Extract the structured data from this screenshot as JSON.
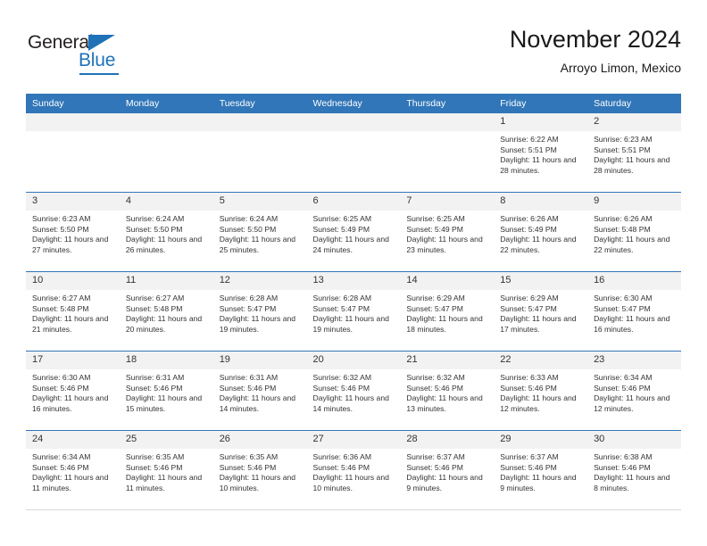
{
  "brand": {
    "name_part1": "General",
    "name_part2": "Blue",
    "triangle_icon": "blue-triangle-logo-mark",
    "accent_color": "#1f72b8"
  },
  "header": {
    "title": "November 2024",
    "subtitle": "Arroyo Limon, Mexico"
  },
  "theme": {
    "header_blue": "#3176b8",
    "daynum_band": "#f2f2f2",
    "text": "#333333"
  },
  "calendar": {
    "weekday_headers": [
      "Sunday",
      "Monday",
      "Tuesday",
      "Wednesday",
      "Thursday",
      "Friday",
      "Saturday"
    ],
    "weeks": [
      [
        {
          "day": "",
          "lines": []
        },
        {
          "day": "",
          "lines": []
        },
        {
          "day": "",
          "lines": []
        },
        {
          "day": "",
          "lines": []
        },
        {
          "day": "",
          "lines": []
        },
        {
          "day": "1",
          "lines": [
            "Sunrise: 6:22 AM",
            "Sunset: 5:51 PM",
            "Daylight: 11 hours and 28 minutes."
          ]
        },
        {
          "day": "2",
          "lines": [
            "Sunrise: 6:23 AM",
            "Sunset: 5:51 PM",
            "Daylight: 11 hours and 28 minutes."
          ]
        }
      ],
      [
        {
          "day": "3",
          "lines": [
            "Sunrise: 6:23 AM",
            "Sunset: 5:50 PM",
            "Daylight: 11 hours and 27 minutes."
          ]
        },
        {
          "day": "4",
          "lines": [
            "Sunrise: 6:24 AM",
            "Sunset: 5:50 PM",
            "Daylight: 11 hours and 26 minutes."
          ]
        },
        {
          "day": "5",
          "lines": [
            "Sunrise: 6:24 AM",
            "Sunset: 5:50 PM",
            "Daylight: 11 hours and 25 minutes."
          ]
        },
        {
          "day": "6",
          "lines": [
            "Sunrise: 6:25 AM",
            "Sunset: 5:49 PM",
            "Daylight: 11 hours and 24 minutes."
          ]
        },
        {
          "day": "7",
          "lines": [
            "Sunrise: 6:25 AM",
            "Sunset: 5:49 PM",
            "Daylight: 11 hours and 23 minutes."
          ]
        },
        {
          "day": "8",
          "lines": [
            "Sunrise: 6:26 AM",
            "Sunset: 5:49 PM",
            "Daylight: 11 hours and 22 minutes."
          ]
        },
        {
          "day": "9",
          "lines": [
            "Sunrise: 6:26 AM",
            "Sunset: 5:48 PM",
            "Daylight: 11 hours and 22 minutes."
          ]
        }
      ],
      [
        {
          "day": "10",
          "lines": [
            "Sunrise: 6:27 AM",
            "Sunset: 5:48 PM",
            "Daylight: 11 hours and 21 minutes."
          ]
        },
        {
          "day": "11",
          "lines": [
            "Sunrise: 6:27 AM",
            "Sunset: 5:48 PM",
            "Daylight: 11 hours and 20 minutes."
          ]
        },
        {
          "day": "12",
          "lines": [
            "Sunrise: 6:28 AM",
            "Sunset: 5:47 PM",
            "Daylight: 11 hours and 19 minutes."
          ]
        },
        {
          "day": "13",
          "lines": [
            "Sunrise: 6:28 AM",
            "Sunset: 5:47 PM",
            "Daylight: 11 hours and 19 minutes."
          ]
        },
        {
          "day": "14",
          "lines": [
            "Sunrise: 6:29 AM",
            "Sunset: 5:47 PM",
            "Daylight: 11 hours and 18 minutes."
          ]
        },
        {
          "day": "15",
          "lines": [
            "Sunrise: 6:29 AM",
            "Sunset: 5:47 PM",
            "Daylight: 11 hours and 17 minutes."
          ]
        },
        {
          "day": "16",
          "lines": [
            "Sunrise: 6:30 AM",
            "Sunset: 5:47 PM",
            "Daylight: 11 hours and 16 minutes."
          ]
        }
      ],
      [
        {
          "day": "17",
          "lines": [
            "Sunrise: 6:30 AM",
            "Sunset: 5:46 PM",
            "Daylight: 11 hours and 16 minutes."
          ]
        },
        {
          "day": "18",
          "lines": [
            "Sunrise: 6:31 AM",
            "Sunset: 5:46 PM",
            "Daylight: 11 hours and 15 minutes."
          ]
        },
        {
          "day": "19",
          "lines": [
            "Sunrise: 6:31 AM",
            "Sunset: 5:46 PM",
            "Daylight: 11 hours and 14 minutes."
          ]
        },
        {
          "day": "20",
          "lines": [
            "Sunrise: 6:32 AM",
            "Sunset: 5:46 PM",
            "Daylight: 11 hours and 14 minutes."
          ]
        },
        {
          "day": "21",
          "lines": [
            "Sunrise: 6:32 AM",
            "Sunset: 5:46 PM",
            "Daylight: 11 hours and 13 minutes."
          ]
        },
        {
          "day": "22",
          "lines": [
            "Sunrise: 6:33 AM",
            "Sunset: 5:46 PM",
            "Daylight: 11 hours and 12 minutes."
          ]
        },
        {
          "day": "23",
          "lines": [
            "Sunrise: 6:34 AM",
            "Sunset: 5:46 PM",
            "Daylight: 11 hours and 12 minutes."
          ]
        }
      ],
      [
        {
          "day": "24",
          "lines": [
            "Sunrise: 6:34 AM",
            "Sunset: 5:46 PM",
            "Daylight: 11 hours and 11 minutes."
          ]
        },
        {
          "day": "25",
          "lines": [
            "Sunrise: 6:35 AM",
            "Sunset: 5:46 PM",
            "Daylight: 11 hours and 11 minutes."
          ]
        },
        {
          "day": "26",
          "lines": [
            "Sunrise: 6:35 AM",
            "Sunset: 5:46 PM",
            "Daylight: 11 hours and 10 minutes."
          ]
        },
        {
          "day": "27",
          "lines": [
            "Sunrise: 6:36 AM",
            "Sunset: 5:46 PM",
            "Daylight: 11 hours and 10 minutes."
          ]
        },
        {
          "day": "28",
          "lines": [
            "Sunrise: 6:37 AM",
            "Sunset: 5:46 PM",
            "Daylight: 11 hours and 9 minutes."
          ]
        },
        {
          "day": "29",
          "lines": [
            "Sunrise: 6:37 AM",
            "Sunset: 5:46 PM",
            "Daylight: 11 hours and 9 minutes."
          ]
        },
        {
          "day": "30",
          "lines": [
            "Sunrise: 6:38 AM",
            "Sunset: 5:46 PM",
            "Daylight: 11 hours and 8 minutes."
          ]
        }
      ]
    ]
  }
}
